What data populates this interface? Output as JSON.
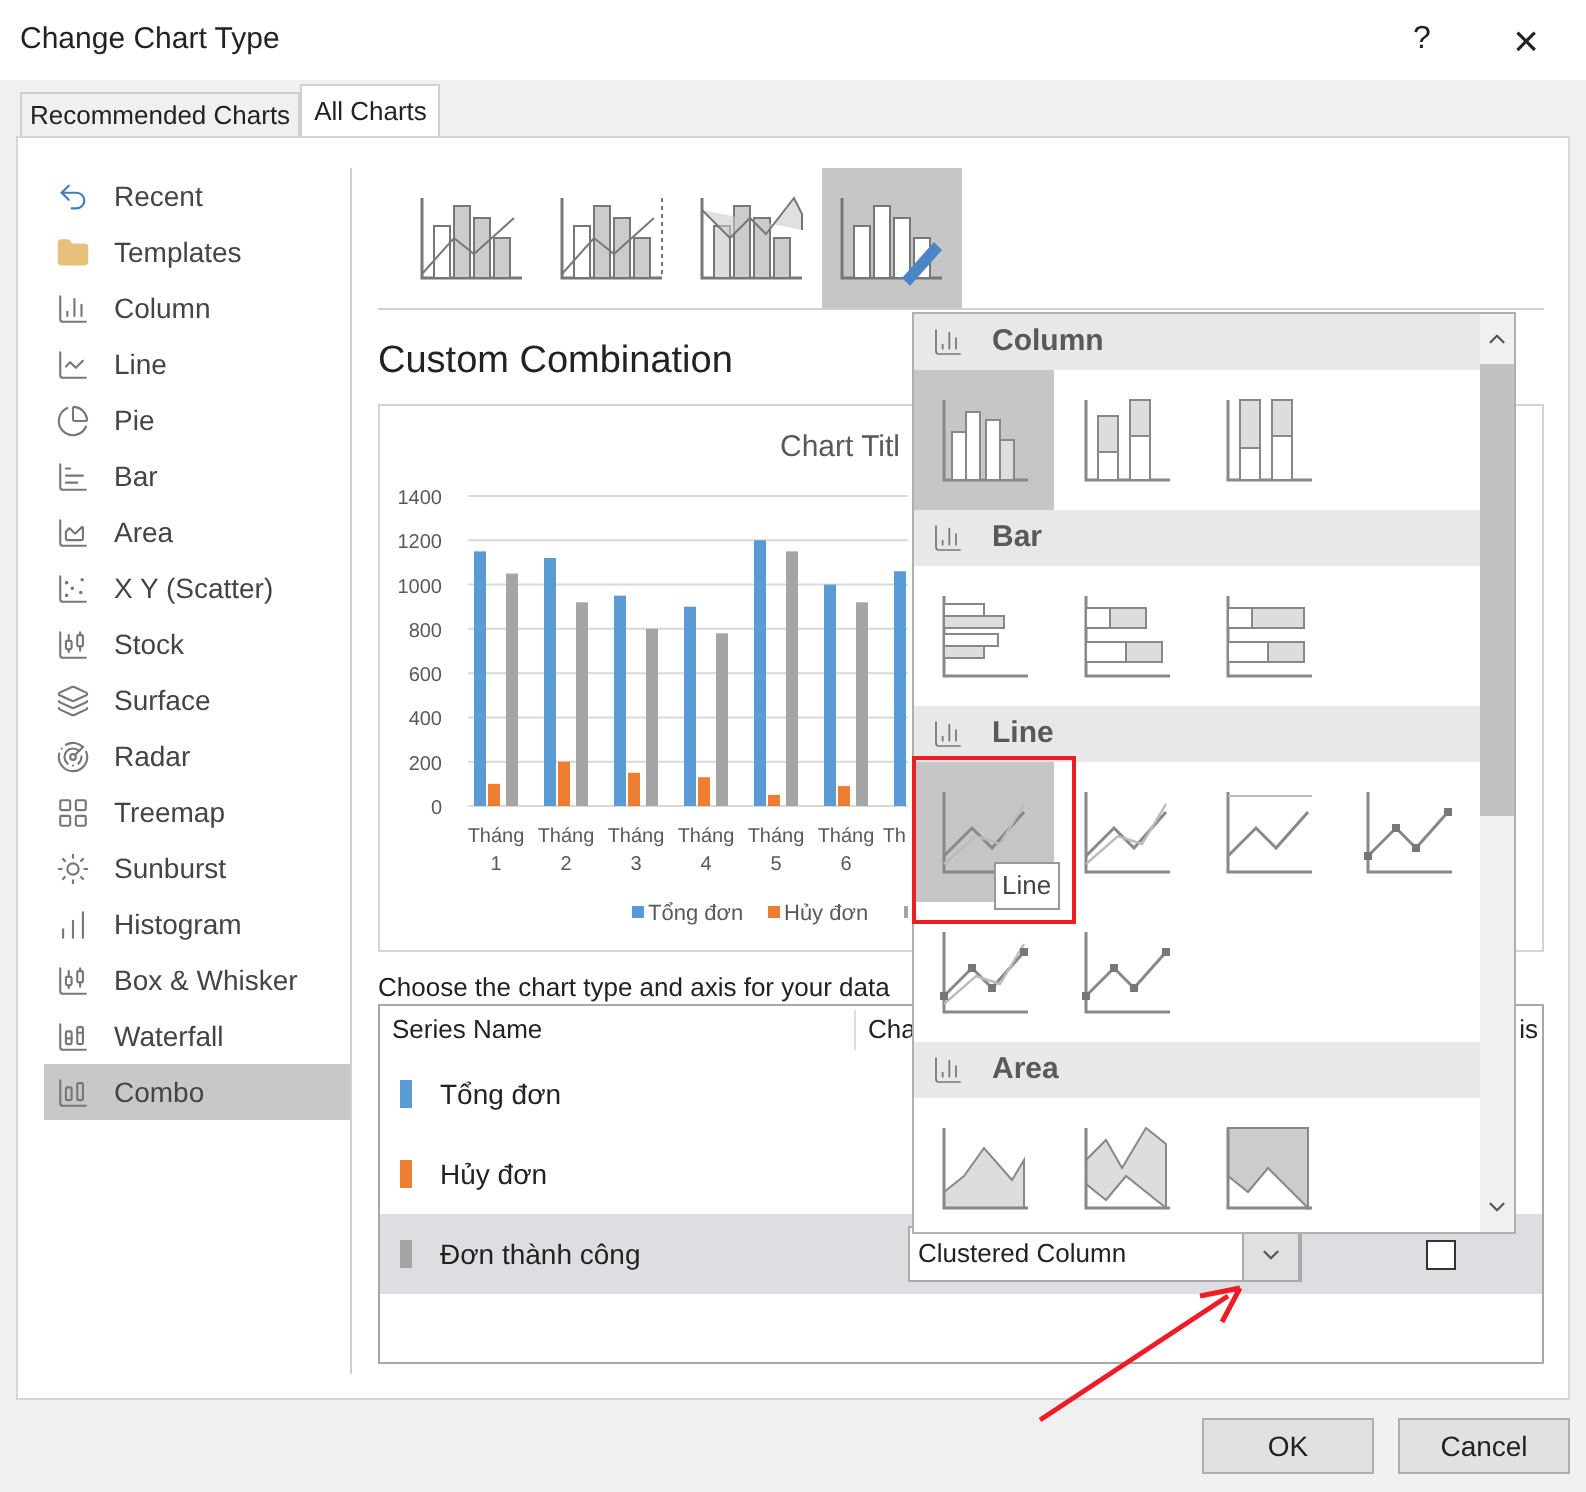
{
  "window": {
    "title": "Change Chart Type",
    "help": "?",
    "close": "×"
  },
  "tabs": [
    {
      "label": "Recommended Charts",
      "selected": false
    },
    {
      "label": "All Charts",
      "selected": true
    }
  ],
  "sidebar": {
    "items": [
      {
        "label": "Recent",
        "selected": false
      },
      {
        "label": "Templates",
        "selected": false
      },
      {
        "label": "Column",
        "selected": false
      },
      {
        "label": "Line",
        "selected": false
      },
      {
        "label": "Pie",
        "selected": false
      },
      {
        "label": "Bar",
        "selected": false
      },
      {
        "label": "Area",
        "selected": false
      },
      {
        "label": "X Y (Scatter)",
        "selected": false
      },
      {
        "label": "Stock",
        "selected": false
      },
      {
        "label": "Surface",
        "selected": false
      },
      {
        "label": "Radar",
        "selected": false
      },
      {
        "label": "Treemap",
        "selected": false
      },
      {
        "label": "Sunburst",
        "selected": false
      },
      {
        "label": "Histogram",
        "selected": false
      },
      {
        "label": "Box & Whisker",
        "selected": false
      },
      {
        "label": "Waterfall",
        "selected": false
      },
      {
        "label": "Combo",
        "selected": true
      }
    ]
  },
  "subtypes": [
    {
      "selected": false
    },
    {
      "selected": false
    },
    {
      "selected": false
    },
    {
      "selected": true
    }
  ],
  "heading": "Custom Combination",
  "preview": {
    "chart_data": {
      "type": "bar",
      "title": "Chart Titl",
      "categories": [
        "Tháng 1",
        "Tháng 2",
        "Tháng 3",
        "Tháng 4",
        "Tháng 5",
        "Tháng 6",
        "Th"
      ],
      "yticks": [
        0,
        200,
        400,
        600,
        800,
        1000,
        1200,
        1400
      ],
      "ylim": [
        0,
        1400
      ],
      "grid": true,
      "legend": true,
      "series": [
        {
          "name": "Tổng đơn",
          "color": "#5b9bd5",
          "values": [
            1150,
            1120,
            950,
            900,
            1200,
            1000,
            1060
          ]
        },
        {
          "name": "Hủy đơn",
          "color": "#ed7d31",
          "values": [
            100,
            200,
            150,
            130,
            50,
            90,
            null
          ]
        },
        {
          "color": "#a5a5a5",
          "values": [
            1050,
            920,
            800,
            780,
            1150,
            920,
            null
          ]
        }
      ]
    }
  },
  "series_prompt": "Choose the chart type and axis for your data",
  "series_table": {
    "columns": [
      "Series Name",
      "Cha",
      "is"
    ],
    "rows": [
      {
        "name": "Tổng đơn",
        "color": "#5b9bd5",
        "selected": false
      },
      {
        "name": "Hủy đơn",
        "color": "#ed7d31",
        "selected": false
      },
      {
        "name": "Đơn thành công",
        "color": "#a5a5a5",
        "selected": true,
        "chart_type": "Clustered Column",
        "secondary_axis": false
      }
    ]
  },
  "chart_type_menu": {
    "sections": [
      {
        "title": "Column",
        "kind": "column",
        "items": [
          {
            "selected": true
          },
          {
            "selected": false
          },
          {
            "selected": false
          }
        ]
      },
      {
        "title": "Bar",
        "kind": "bar",
        "items": [
          {
            "selected": false
          },
          {
            "selected": false
          },
          {
            "selected": false
          }
        ]
      },
      {
        "title": "Line",
        "kind": "line",
        "items": [
          {
            "selected": true
          },
          {
            "selected": false
          },
          {
            "selected": false
          },
          {
            "selected": false
          },
          {
            "selected": false
          },
          {
            "selected": false
          }
        ]
      },
      {
        "title": "Area",
        "kind": "area",
        "items": [
          {
            "selected": false
          },
          {
            "selected": false
          },
          {
            "selected": false
          }
        ]
      }
    ],
    "tooltip": "Line"
  },
  "buttons": [
    "OK",
    "Cancel"
  ]
}
